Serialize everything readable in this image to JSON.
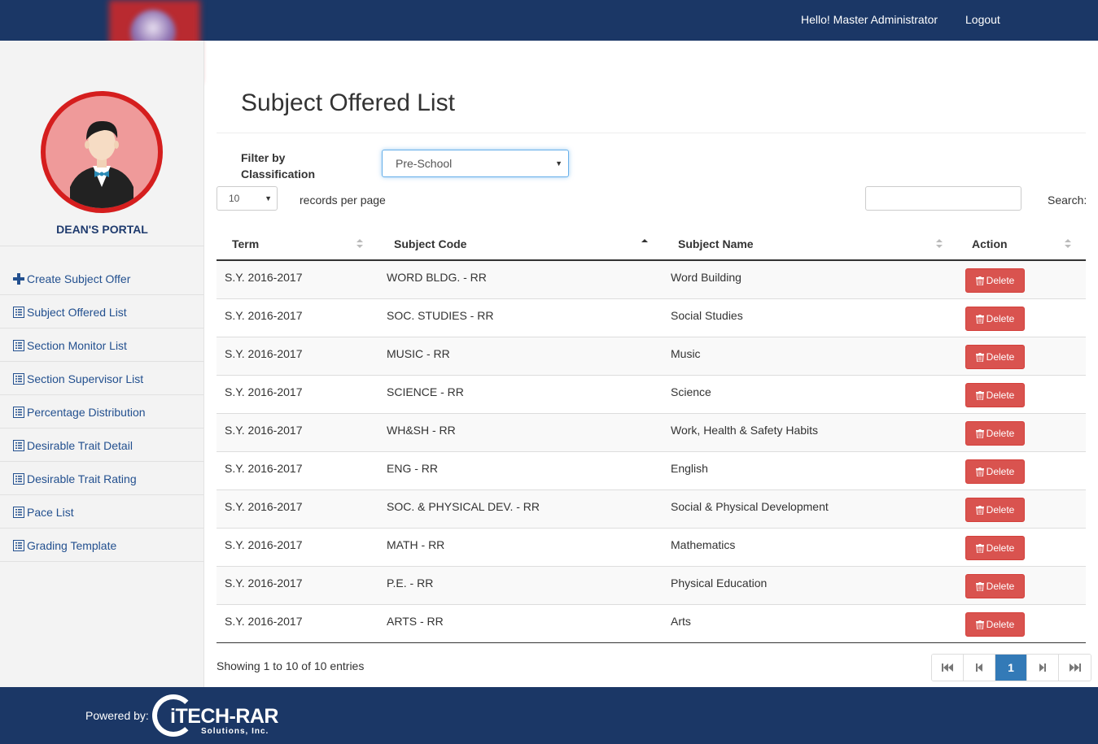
{
  "header": {
    "greeting": "Hello! Master Administrator",
    "logout_label": "Logout"
  },
  "sidebar": {
    "portal_title": "DEAN'S PORTAL",
    "items": [
      {
        "label": "Create Subject Offer",
        "icon": "plus-icon"
      },
      {
        "label": "Subject Offered List",
        "icon": "list-icon"
      },
      {
        "label": "Section Monitor List",
        "icon": "list-icon"
      },
      {
        "label": "Section Supervisor List",
        "icon": "list-icon"
      },
      {
        "label": "Percentage Distribution",
        "icon": "list-icon"
      },
      {
        "label": "Desirable Trait Detail",
        "icon": "list-icon"
      },
      {
        "label": "Desirable Trait Rating",
        "icon": "list-icon"
      },
      {
        "label": "Pace List",
        "icon": "list-icon"
      },
      {
        "label": "Grading Template",
        "icon": "list-icon"
      }
    ]
  },
  "main": {
    "title": "Subject Offered List",
    "filter_label_1": "Filter by",
    "filter_label_2": "Classification",
    "filter_value": "Pre-School",
    "records_per_page_value": "10",
    "records_per_page_label": "records per page",
    "search_label": "Search:",
    "search_value": "",
    "columns": [
      "Term",
      "Subject Code",
      "Subject Name",
      "Action"
    ],
    "sorted_column": "Subject Code",
    "rows": [
      {
        "term": "S.Y. 2016-2017",
        "code": "WORD BLDG. - RR",
        "name": "Word Building"
      },
      {
        "term": "S.Y. 2016-2017",
        "code": "SOC. STUDIES - RR",
        "name": "Social Studies"
      },
      {
        "term": "S.Y. 2016-2017",
        "code": "MUSIC - RR",
        "name": "Music"
      },
      {
        "term": "S.Y. 2016-2017",
        "code": "SCIENCE - RR",
        "name": "Science"
      },
      {
        "term": "S.Y. 2016-2017",
        "code": "WH&SH - RR",
        "name": "Work, Health & Safety Habits"
      },
      {
        "term": "S.Y. 2016-2017",
        "code": "ENG - RR",
        "name": "English"
      },
      {
        "term": "S.Y. 2016-2017",
        "code": "SOC. & PHYSICAL DEV. - RR",
        "name": "Social & Physical Development"
      },
      {
        "term": "S.Y. 2016-2017",
        "code": "MATH - RR",
        "name": "Mathematics"
      },
      {
        "term": "S.Y. 2016-2017",
        "code": "P.E. - RR",
        "name": "Physical Education"
      },
      {
        "term": "S.Y. 2016-2017",
        "code": "ARTS - RR",
        "name": "Arts"
      }
    ],
    "delete_label": "Delete",
    "info": "Showing 1 to 10 of 10 entries",
    "current_page": "1"
  },
  "footer": {
    "powered_by": "Powered by:",
    "brand_name": "iTECH-RAR",
    "brand_sub": "Solutions, Inc."
  },
  "colors": {
    "navbar": "#1b3766",
    "delete_button": "#d9534f",
    "active_page": "#337ab7",
    "sidebar_link": "#23508f",
    "avatar_ring": "#d51e1e"
  }
}
